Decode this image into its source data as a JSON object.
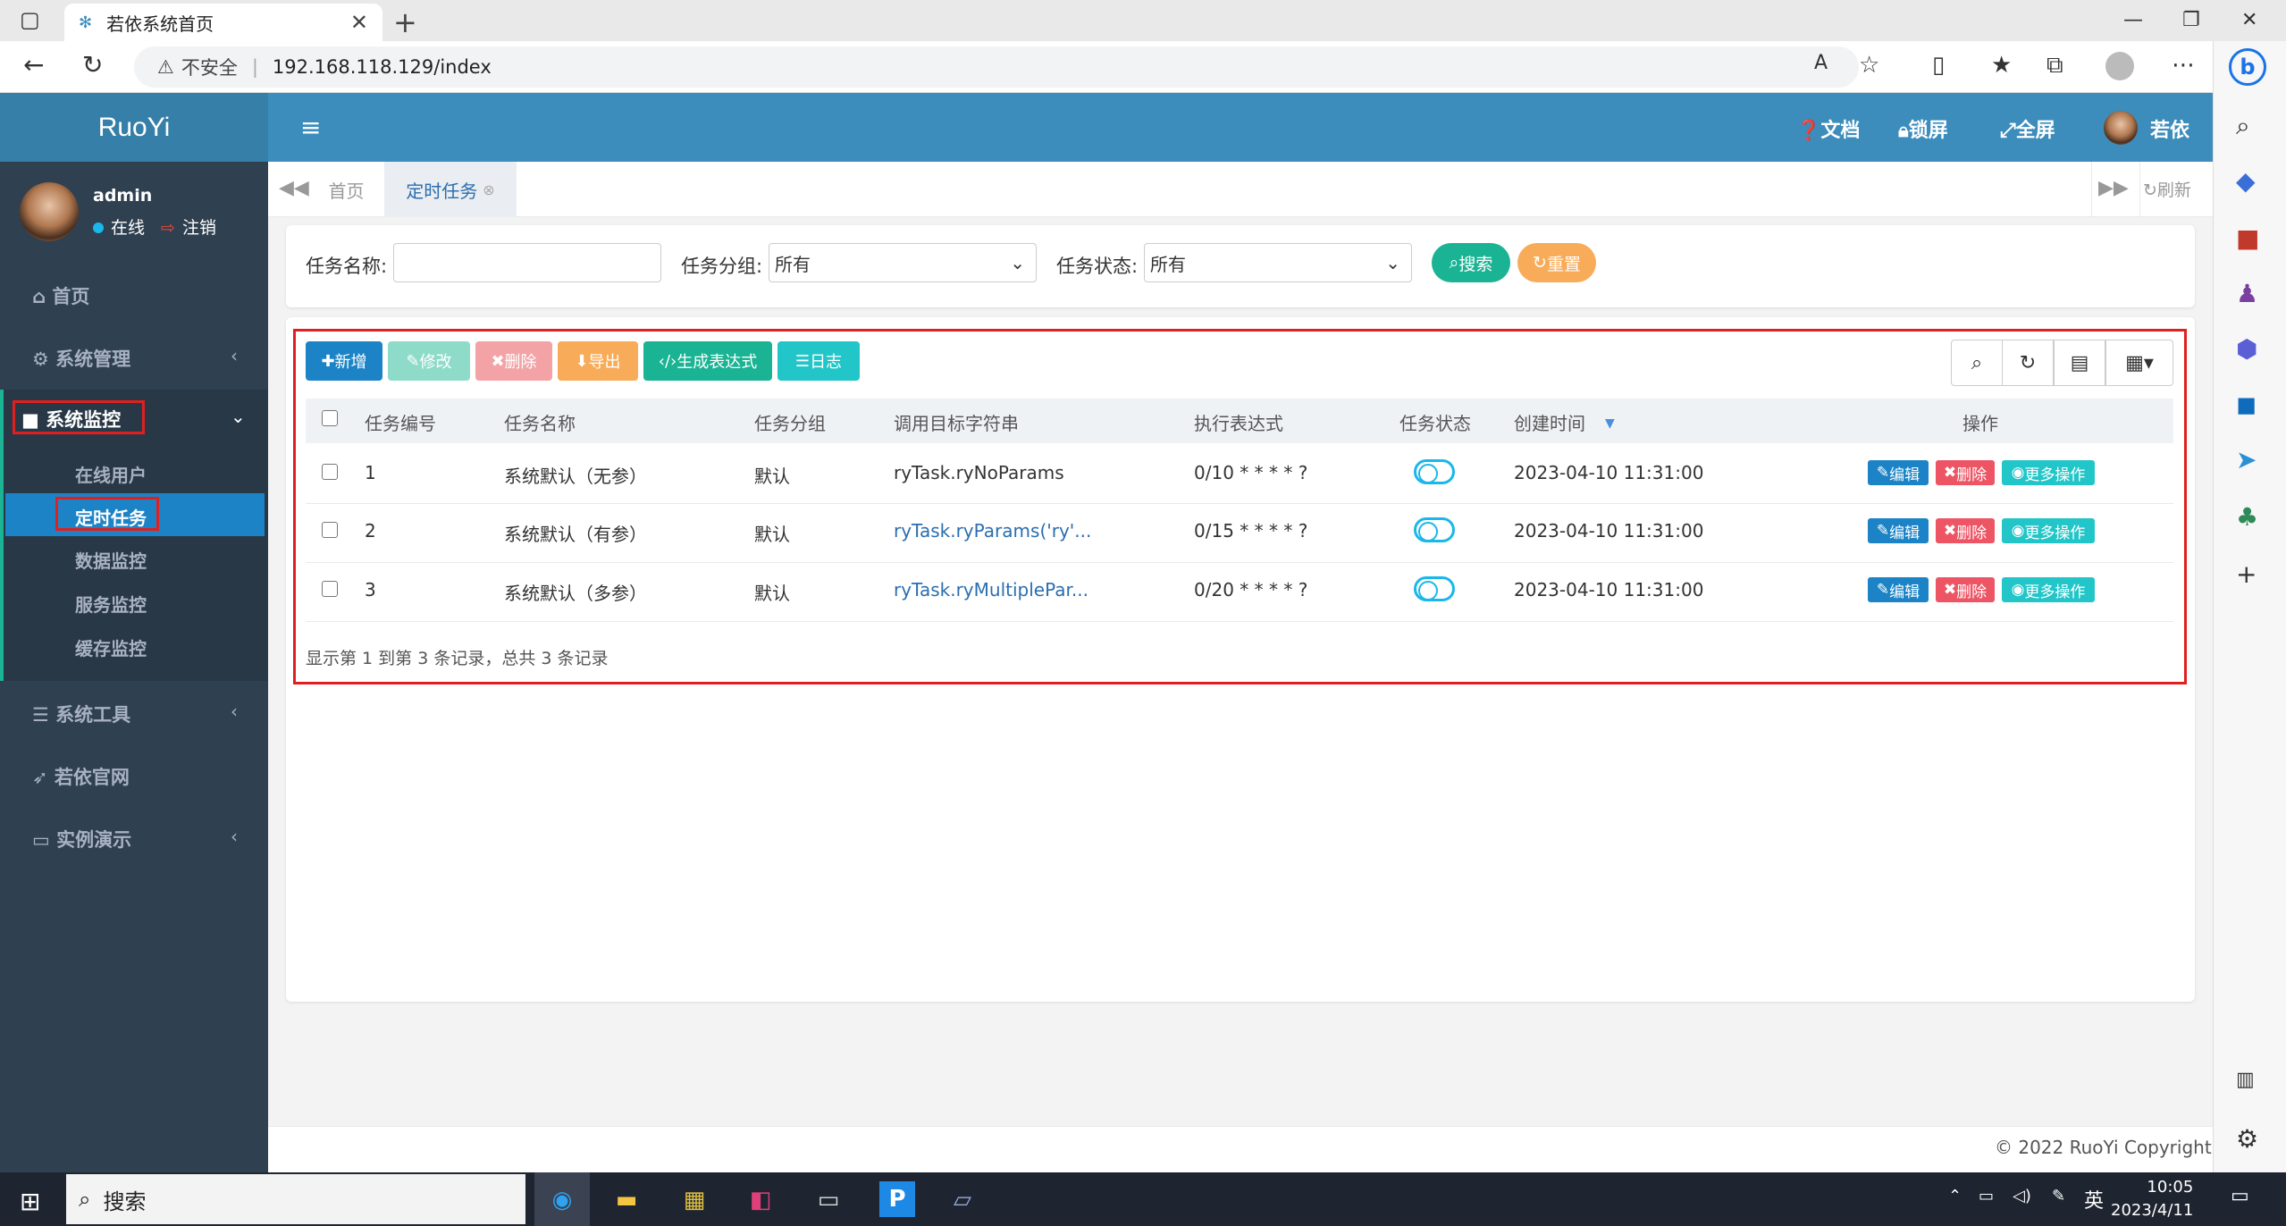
{
  "browser": {
    "tab_title": "若依系统首页",
    "security_label": "不安全",
    "url": "192.168.118.129/index"
  },
  "app": {
    "logo": "RuoYi",
    "header_links": {
      "docs": "文档",
      "lock": "锁屏",
      "fullscreen": "全屏",
      "user": "若依"
    }
  },
  "user": {
    "name": "admin",
    "status": "在线",
    "logout": "注销"
  },
  "sidebar": {
    "items": [
      {
        "label": "首页",
        "icon": "home-icon"
      },
      {
        "label": "系统管理",
        "icon": "gear-icon"
      },
      {
        "label": "系统监控",
        "icon": "video-icon"
      },
      {
        "label": "系统工具",
        "icon": "bars-icon"
      },
      {
        "label": "若依官网",
        "icon": "send-icon"
      },
      {
        "label": "实例演示",
        "icon": "desktop-icon"
      }
    ],
    "monitor_sub": [
      "在线用户",
      "定时任务",
      "数据监控",
      "服务监控",
      "缓存监控"
    ]
  },
  "tabs": {
    "home": "首页",
    "job": "定时任务",
    "refresh": "刷新"
  },
  "search": {
    "name_label": "任务名称:",
    "name_value": "",
    "group_label": "任务分组:",
    "group_value": "所有",
    "status_label": "任务状态:",
    "status_value": "所有",
    "search_btn": "搜索",
    "reset_btn": "重置"
  },
  "toolbar": {
    "add": "新增",
    "edit": "修改",
    "delete": "删除",
    "export": "导出",
    "cron": "生成表达式",
    "log": "日志"
  },
  "table": {
    "headers": [
      "任务编号",
      "任务名称",
      "任务分组",
      "调用目标字符串",
      "执行表达式",
      "任务状态",
      "创建时间",
      "操作"
    ],
    "rows": [
      {
        "id": "1",
        "name": "系统默认（无参）",
        "group": "默认",
        "target": "ryTask.ryNoParams",
        "cron": "0/10 * * * * ?",
        "created": "2023-04-10 11:31:00"
      },
      {
        "id": "2",
        "name": "系统默认（有参）",
        "group": "默认",
        "target": "ryTask.ryParams('ry'...",
        "cron": "0/15 * * * * ?",
        "created": "2023-04-10 11:31:00"
      },
      {
        "id": "3",
        "name": "系统默认（多参）",
        "group": "默认",
        "target": "ryTask.ryMultiplePar...",
        "cron": "0/20 * * * * ?",
        "created": "2023-04-10 11:31:00"
      }
    ],
    "row_actions": {
      "edit": "编辑",
      "delete": "删除",
      "more": "更多操作"
    },
    "pagination": "显示第 1 到第 3 条记录，总共 3 条记录"
  },
  "footer": {
    "copyright": "© 2022 RuoYi Copyright"
  },
  "taskbar": {
    "search": "搜索",
    "ime": "英",
    "time": "10:05",
    "date": "2023/4/11"
  }
}
